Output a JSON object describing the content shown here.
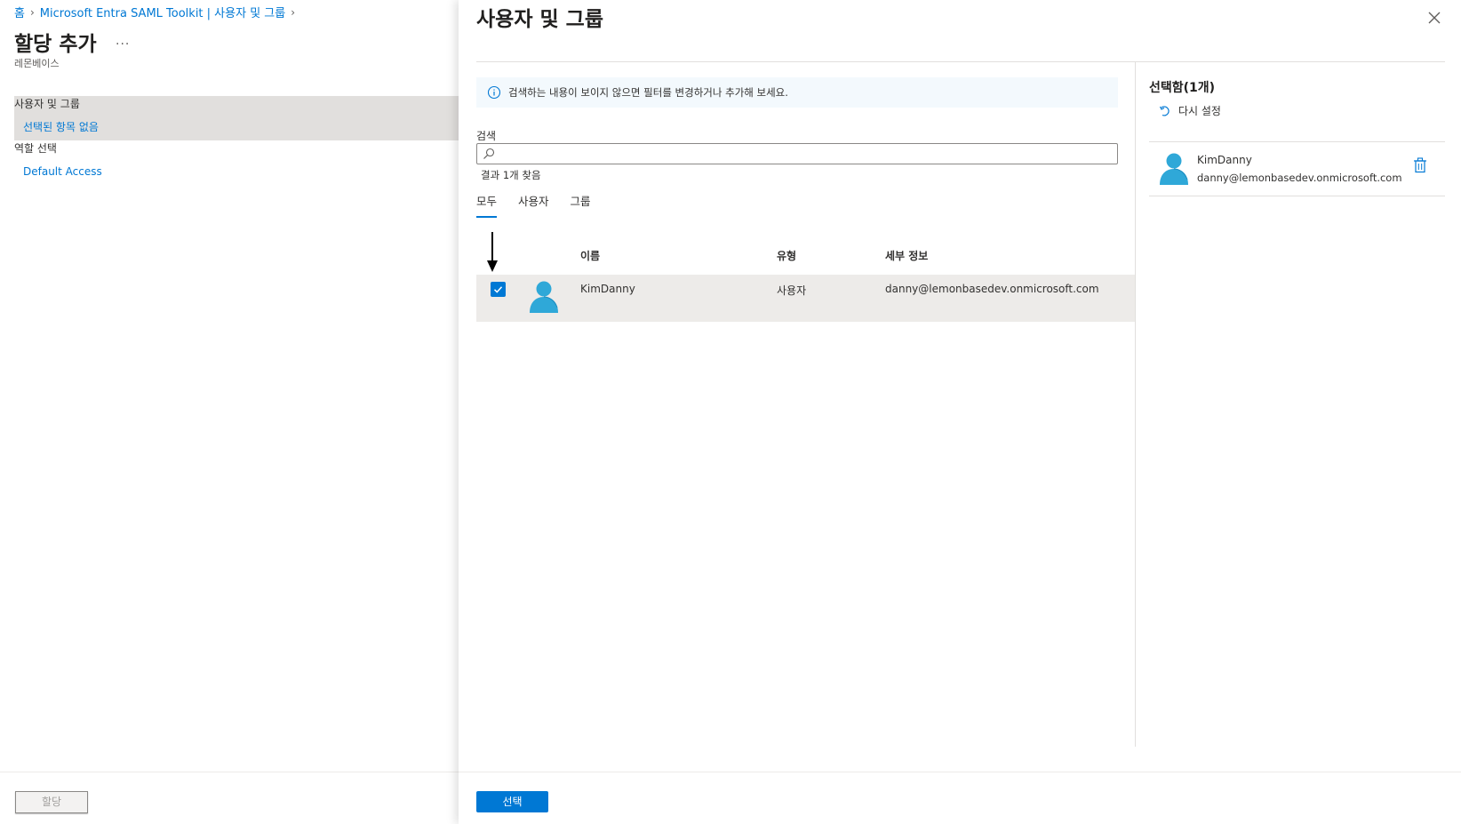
{
  "breadcrumb": {
    "home": "홈",
    "app": "Microsoft Entra SAML Toolkit | 사용자 및 그룹"
  },
  "left": {
    "title": "할당 추가",
    "more": "...",
    "subtitle": "레몬베이스",
    "users_groups_label": "사용자 및 그룹",
    "users_groups_value": "선택된 항목 없음",
    "role_label": "역할 선택",
    "role_value": "Default Access",
    "assign_button": "할당"
  },
  "panel": {
    "title": "사용자 및 그룹",
    "info": "검색하는 내용이 보이지 않으면 필터를 변경하거나 추가해 보세요.",
    "search_label": "검색",
    "search_value": "",
    "result_count": "결과 1개 찾음",
    "tabs": [
      "모두",
      "사용자",
      "그룹"
    ],
    "active_tab": "모두",
    "columns": {
      "name": "이름",
      "type": "유형",
      "details": "세부 정보"
    },
    "rows": [
      {
        "name": "KimDanny",
        "type": "사용자",
        "details": "danny@lemonbasedev.onmicrosoft.com",
        "checked": true
      }
    ],
    "select_button": "선택"
  },
  "selected": {
    "title": "선택함(1개)",
    "reset": "다시 설정",
    "items": [
      {
        "name": "KimDanny",
        "email": "danny@lemonbasedev.onmicrosoft.com"
      }
    ]
  },
  "colors": {
    "accent": "#0078d4",
    "avatar": "#2fa8d8",
    "row_selected_bg": "#edebe9"
  }
}
